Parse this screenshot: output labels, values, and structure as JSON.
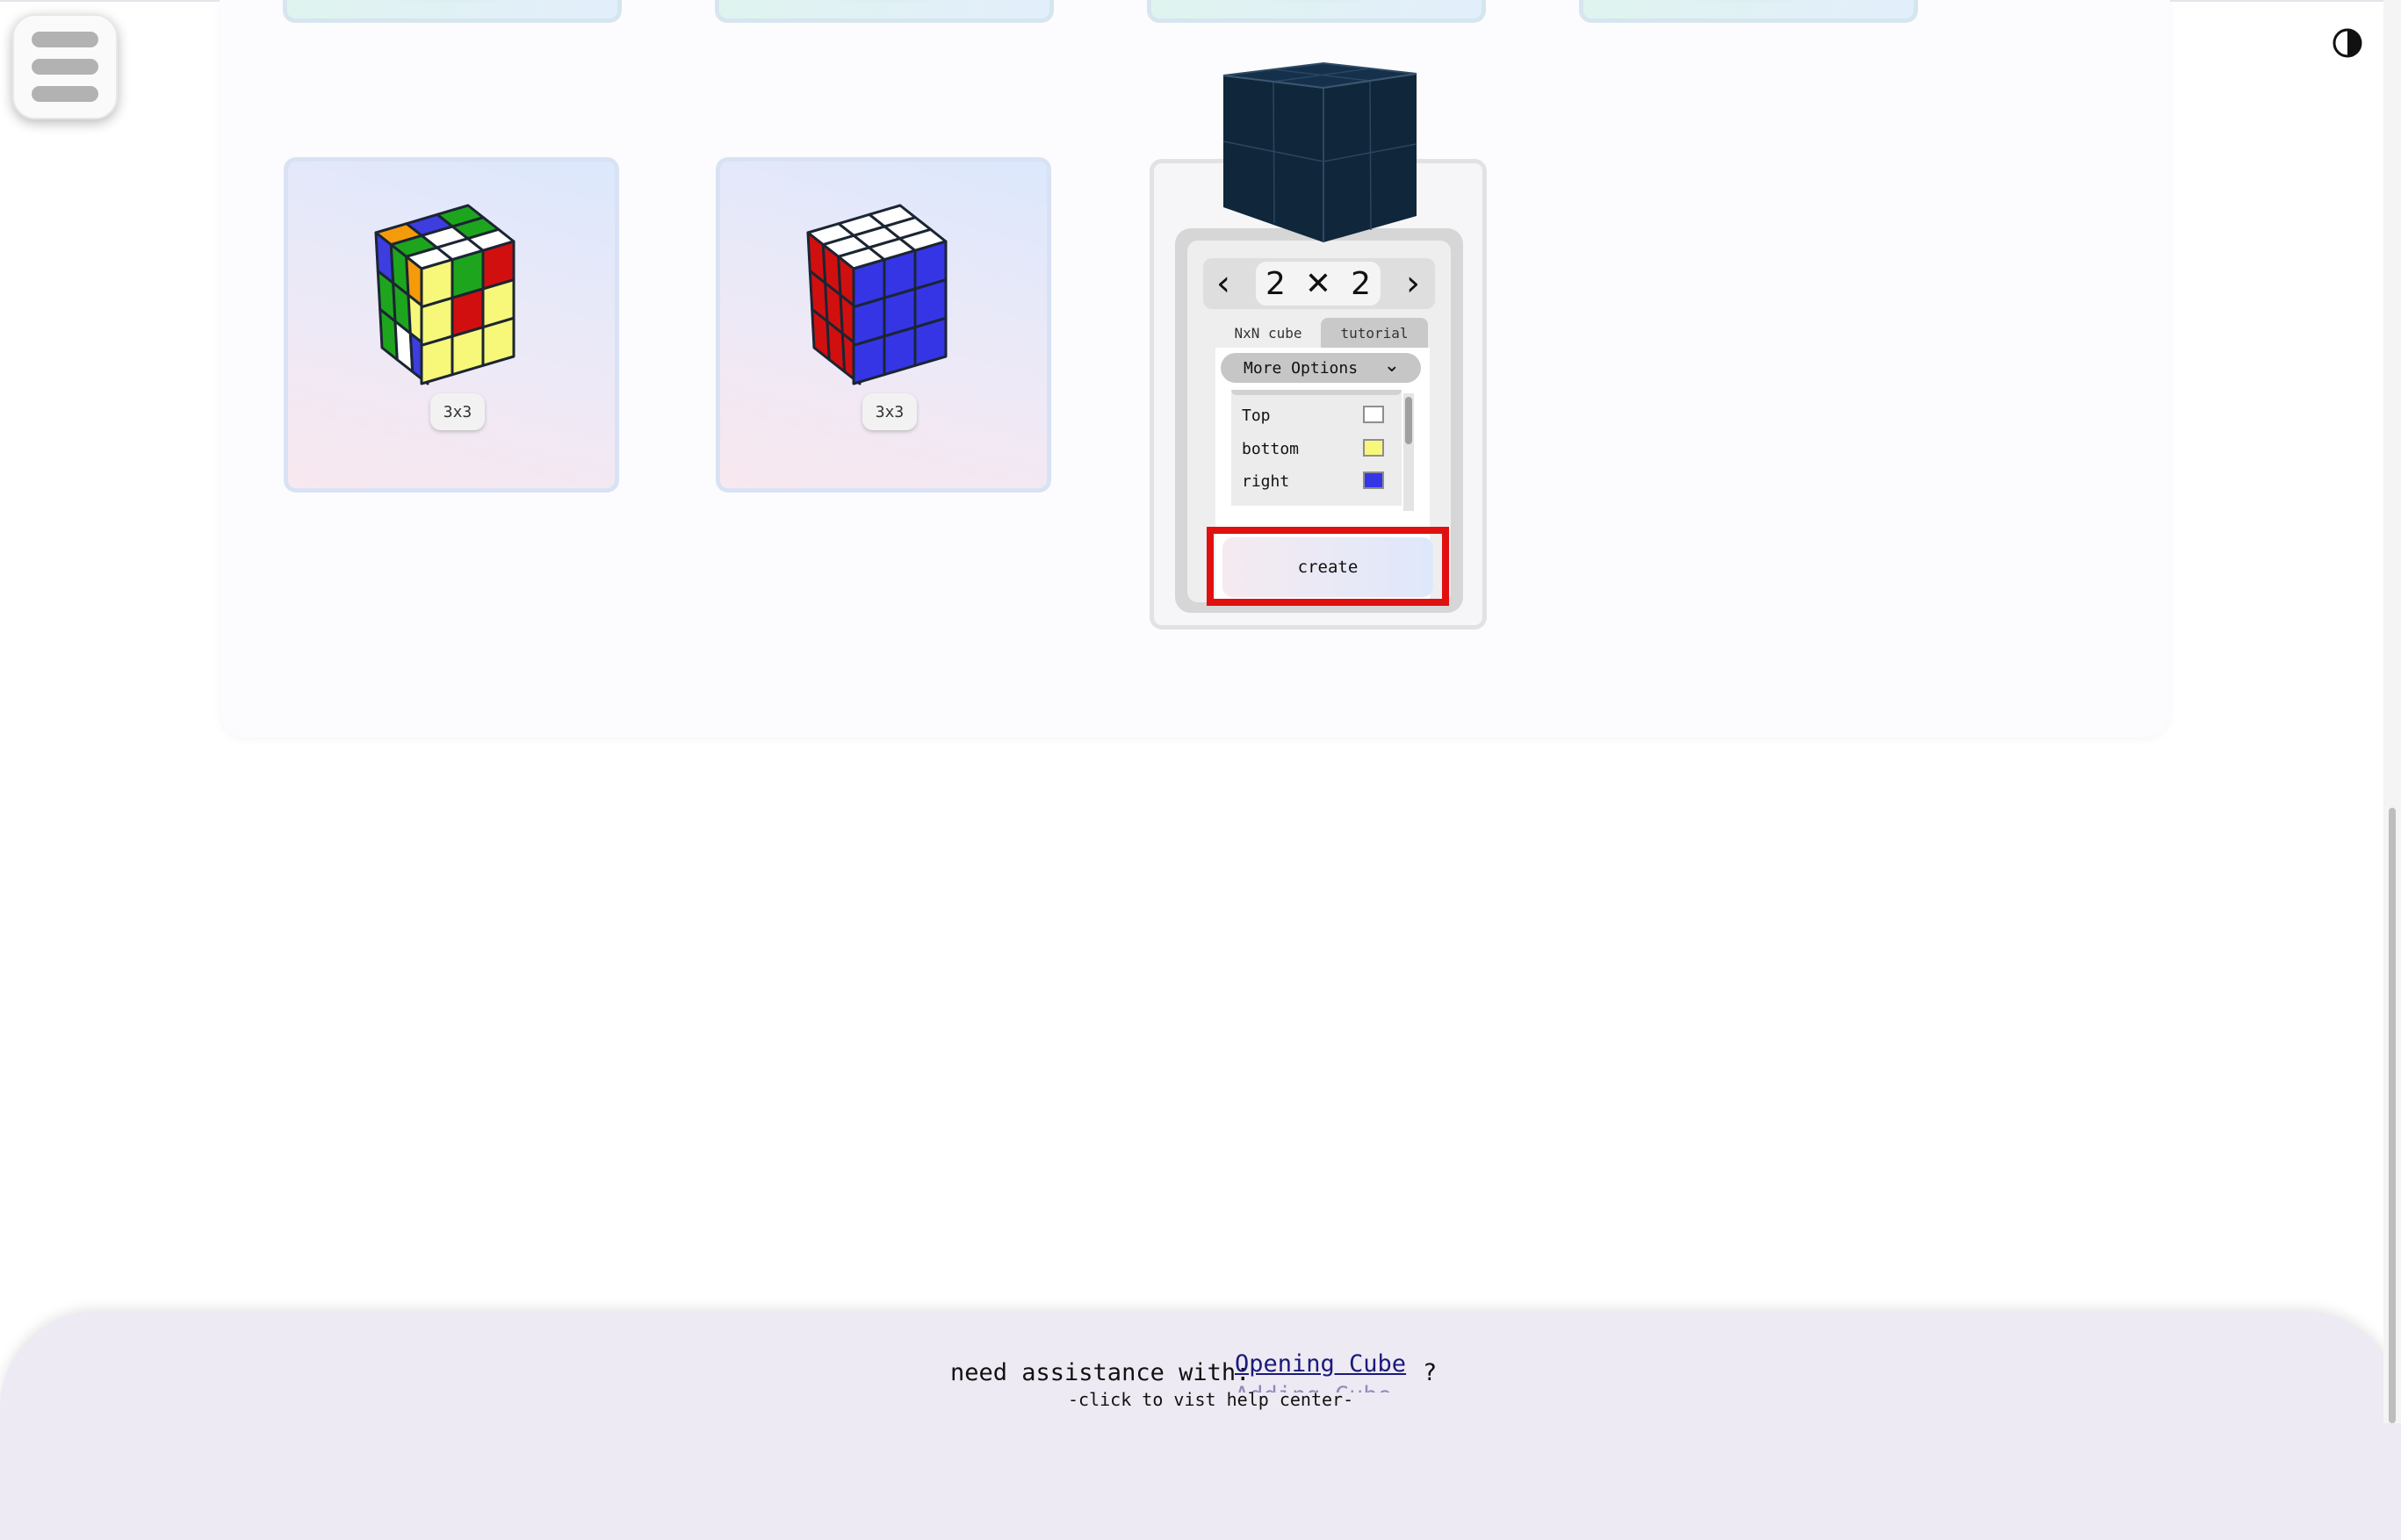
{
  "menu": {
    "label": "menu"
  },
  "cubes": [
    {
      "label": "3x3"
    },
    {
      "label": "3x3"
    }
  ],
  "creator": {
    "size_prev": "‹",
    "size_n1": "2",
    "size_x": "✕",
    "size_n2": "2",
    "size_next": "›",
    "tabs": [
      "NxN cube",
      "tutorial"
    ],
    "more_options": "More Options",
    "faces": [
      {
        "name": "Top",
        "color": "#ffffff"
      },
      {
        "name": "bottom",
        "color": "#f7f77a"
      },
      {
        "name": "right",
        "color": "#3535e6"
      }
    ],
    "create_label": "create"
  },
  "footer": {
    "prompt": "need assistance with:",
    "link": "Opening Cube",
    "link_next": "Adding Cube",
    "qmark": "?",
    "hint": "-click to vist help center-"
  }
}
